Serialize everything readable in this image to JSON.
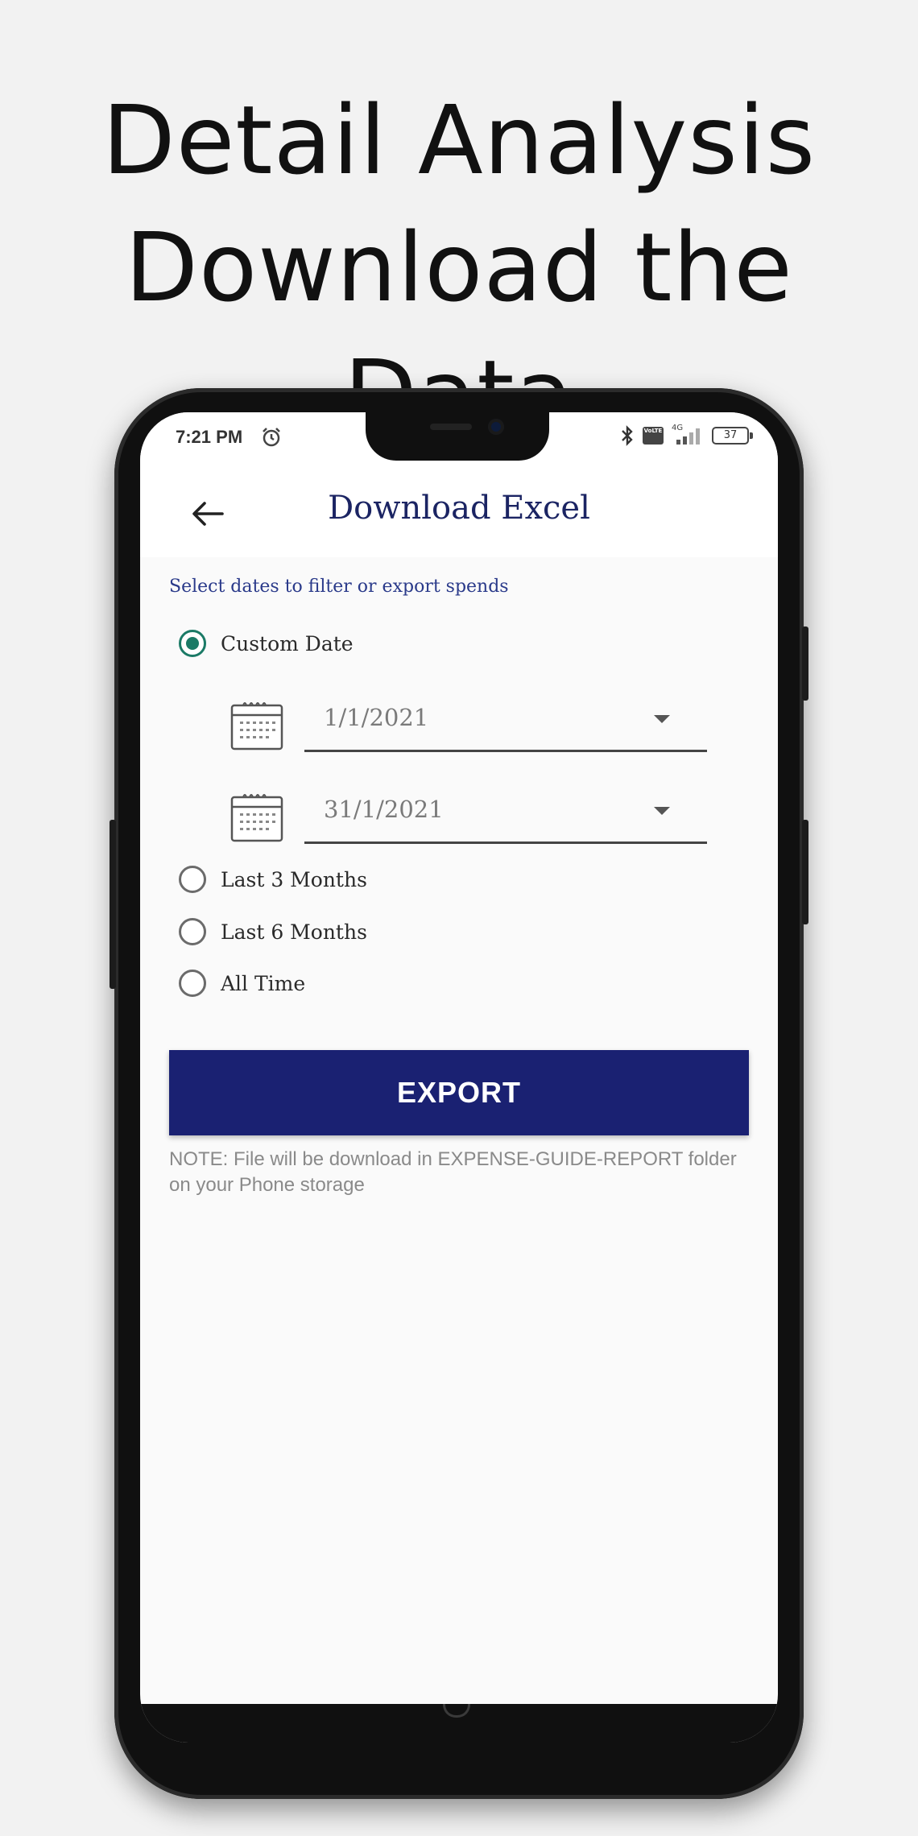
{
  "headline": {
    "line1": "Detail Analysis",
    "line2": "Download the Data"
  },
  "statusbar": {
    "time": "7:21 PM",
    "battery": "37",
    "network": "4G",
    "volte": "VoLTE"
  },
  "appbar": {
    "title": "Download Excel"
  },
  "form": {
    "subtitle": "Select dates to filter or export spends",
    "options": {
      "custom": "Custom Date",
      "last3": "Last 3 Months",
      "last6": "Last 6 Months",
      "all": "All Time"
    },
    "selected": "custom",
    "from_date": "1/1/2021",
    "to_date": "31/1/2021",
    "export_label": "EXPORT",
    "note": "NOTE: File will be download in EXPENSE-GUIDE-REPORT folder on your Phone storage"
  },
  "colors": {
    "primary": "#1a2172",
    "accent": "#1b7a66",
    "title": "#1b2463"
  },
  "icons": [
    "alarm-icon",
    "bluetooth-icon",
    "volte-icon",
    "signal-icon",
    "battery-icon",
    "back-arrow-icon",
    "calendar-icon",
    "dropdown-arrow-icon"
  ]
}
